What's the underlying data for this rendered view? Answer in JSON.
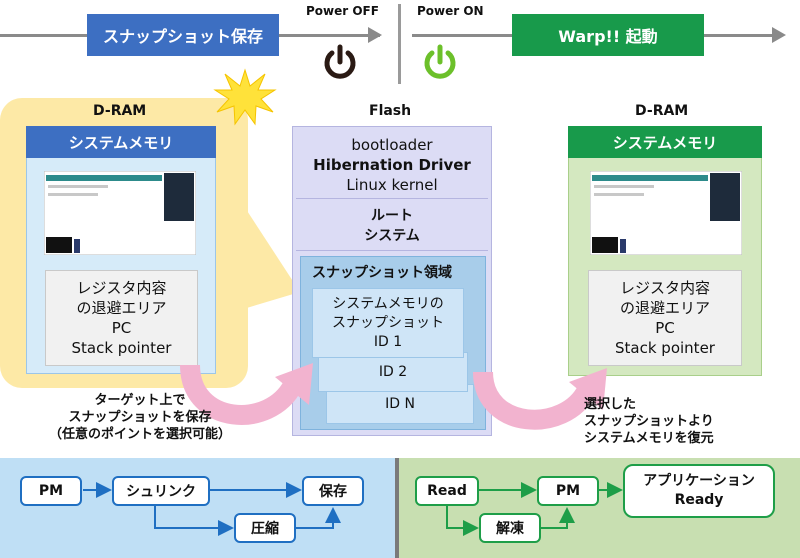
{
  "timeline": {
    "snapshot_save": "スナップショット保存",
    "power_off": "Power OFF",
    "power_on": "Power ON",
    "warp_boot": "Warp!! 起動"
  },
  "left_dram": {
    "heading": "D-RAM",
    "title": "システムメモリ",
    "register_lines": [
      "レジスタ内容",
      "の退避エリア",
      "PC",
      "Stack pointer"
    ]
  },
  "flash": {
    "heading": "Flash",
    "boot_lines": [
      "bootloader",
      "Hibernation Driver",
      "Linux kernel"
    ],
    "root_lines": [
      "ルート",
      "システム"
    ],
    "snapshot_area_title": "スナップショット領域",
    "snapshot_card_lines": [
      "システムメモリの",
      "スナップショット",
      "ID 1"
    ],
    "id2": "ID 2",
    "idn": "ID N"
  },
  "right_dram": {
    "heading": "D-RAM",
    "title": "システムメモリ",
    "register_lines": [
      "レジスタ内容",
      "の退避エリア",
      "PC",
      "Stack pointer"
    ]
  },
  "notes": {
    "left_lines": [
      "ターゲット上で",
      "スナップショットを保存",
      "（任意のポイントを選択可能）"
    ],
    "right_lines": [
      "選択した",
      "スナップショットより",
      "システムメモリを復元"
    ]
  },
  "bottom_left_flow": {
    "pm": "PM",
    "shrink": "シュリンク",
    "save": "保存",
    "compress": "圧縮"
  },
  "bottom_right_flow": {
    "read": "Read",
    "pm": "PM",
    "app_lines": [
      "アプリケーション",
      "Ready"
    ],
    "decompress": "解凍"
  },
  "colors": {
    "blue_dark": "#3d6fc2",
    "blue_light": "#d6ebf9",
    "green_dark": "#189a4b",
    "green_light": "#d4e8c0",
    "yellow_glow": "#fde9a6",
    "flash_bg": "#dcdcf5",
    "pink_arrow": "#f2b3cf",
    "bottom_blue": "#bfdff5",
    "bottom_green": "#c8dfb1",
    "power_off": "#2a1a14",
    "power_on": "#6cc02a"
  },
  "icons": [
    "power-off-icon",
    "power-on-icon",
    "burst-icon",
    "screenshot-thumbnail-icon"
  ]
}
